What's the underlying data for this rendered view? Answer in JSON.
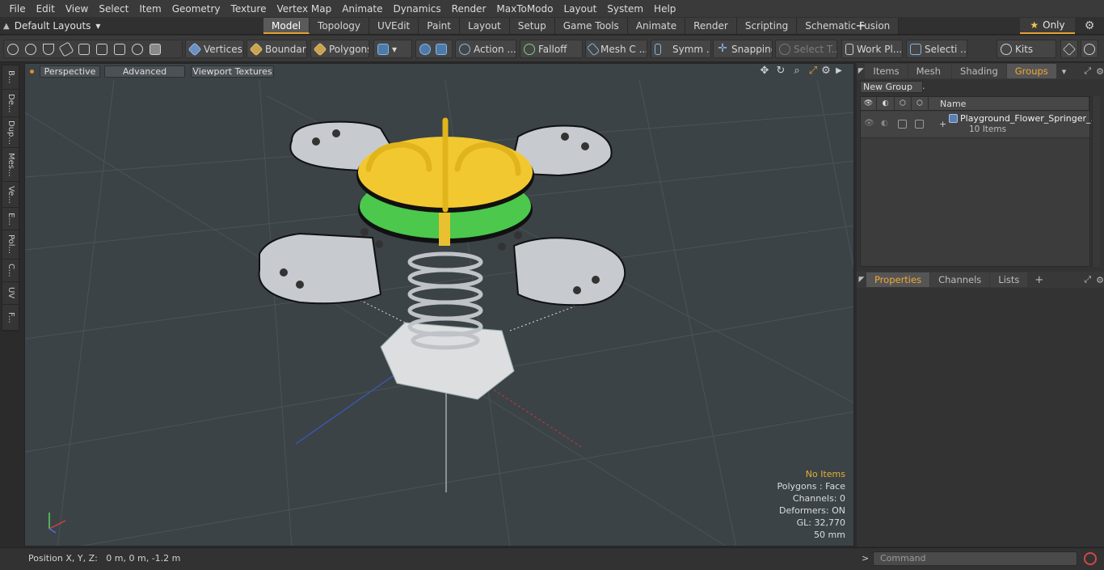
{
  "menu": [
    "File",
    "Edit",
    "View",
    "Select",
    "Item",
    "Geometry",
    "Texture",
    "Vertex Map",
    "Animate",
    "Dynamics",
    "Render",
    "MaxToModo",
    "Layout",
    "System",
    "Help"
  ],
  "layout_selector": "Default Layouts",
  "tabs": [
    "Model",
    "Topology",
    "UVEdit",
    "Paint",
    "Layout",
    "Setup",
    "Game Tools",
    "Animate",
    "Render",
    "Scripting",
    "Schematic Fusion"
  ],
  "active_tab": "Model",
  "only_button": "Only",
  "toolbar": {
    "vertices": "Vertices",
    "boundary": "Boundary",
    "polygons": "Polygons",
    "action": "Action ...",
    "falloff": "Falloff",
    "mesh": "Mesh C ...",
    "symmetry": "Symm ...",
    "snapping": "Snapping",
    "select_t": "Select T...",
    "workplane": "Work Pl...",
    "selection": "Selecti ...",
    "kits": "Kits"
  },
  "left_tabs": [
    "B...",
    "De...",
    "Dup...",
    "Mes...",
    "Ve...",
    "E...",
    "Pol...",
    "C...",
    "UV",
    "F..."
  ],
  "viewport": {
    "perspective": "Perspective",
    "advanced": "Advanced",
    "viewport_textures": "Viewport Textures"
  },
  "stats": {
    "items": "No Items",
    "polygons": "Polygons : Face",
    "channels": "Channels: 0",
    "deformers": "Deformers: ON",
    "gl": "GL: 32,770",
    "scale": "50 mm"
  },
  "status": {
    "position": "Position X, Y, Z:   0 m, 0 m, -1.2 m"
  },
  "right_panel": {
    "tabs": [
      "Items",
      "Mesh ...",
      "Shading",
      "Groups"
    ],
    "active_tab": "Groups",
    "new_group": "New Group",
    "column_name": "Name",
    "group_name": "Playground_Flower_Springer_...",
    "group_count": "10 Items",
    "lower_tabs": [
      "Properties",
      "Channels",
      "Lists"
    ],
    "lower_active": "Properties"
  },
  "command_placeholder": "Command",
  "colors": {
    "accent": "#e5a030",
    "seat_yellow": "#f2c830",
    "disc_green": "#4cc84c"
  }
}
